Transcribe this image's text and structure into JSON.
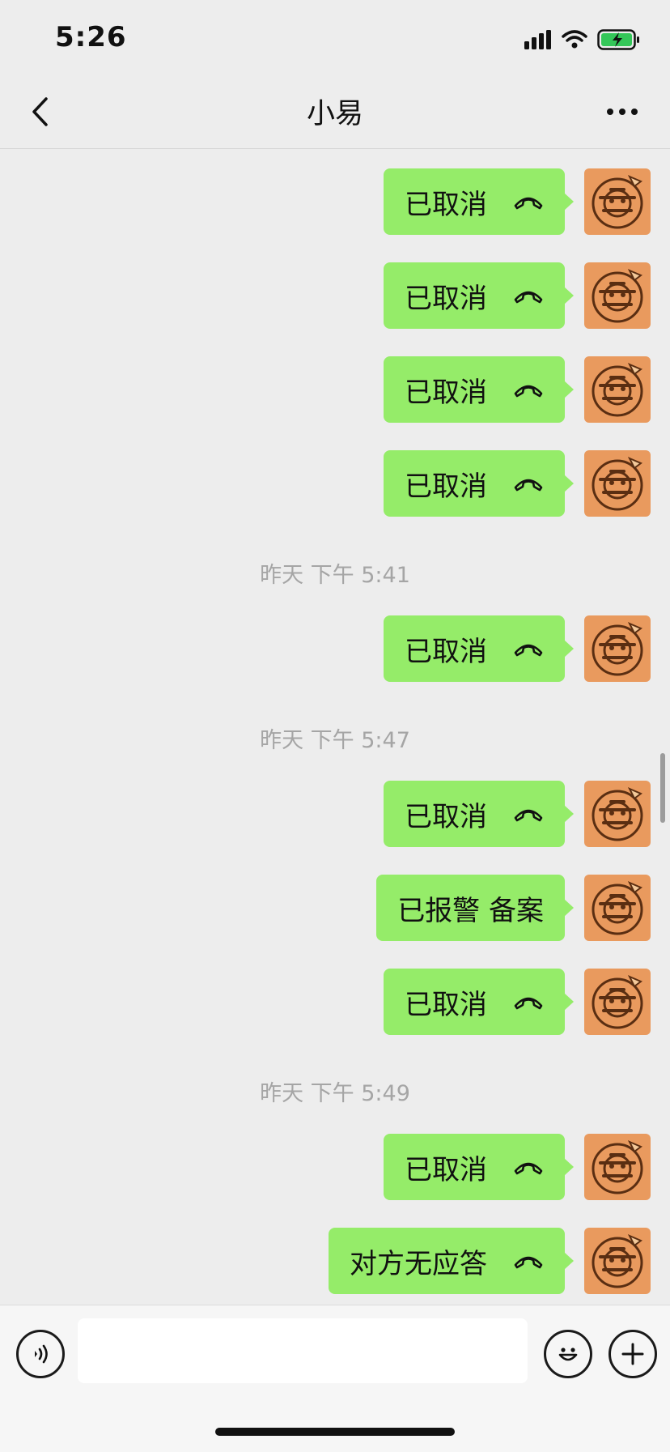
{
  "status_bar": {
    "time": "5:26"
  },
  "header": {
    "title": "小易"
  },
  "messages": {
    "m1": "已取消",
    "m2": "已取消",
    "m3": "已取消",
    "m4": "已取消",
    "t1": "昨天 下午 5:41",
    "m5": "已取消",
    "t2": "昨天 下午 5:47",
    "m6": "已取消",
    "m7": "已报警 备案",
    "m8": "已取消",
    "t3": "昨天 下午 5:49",
    "m9": "已取消",
    "m10": "对方无应答"
  },
  "icons": {
    "back": "chevron-left-icon",
    "more": "more-dots-icon",
    "call": "phone-hangup-icon",
    "voice": "voice-icon",
    "emoji": "emoji-icon",
    "plus": "plus-icon"
  },
  "colors": {
    "bubble": "#95ec69",
    "background": "#ededed",
    "avatar": "#e99a5e",
    "timestamp": "#a5a5a5",
    "battery": "#34c759"
  }
}
